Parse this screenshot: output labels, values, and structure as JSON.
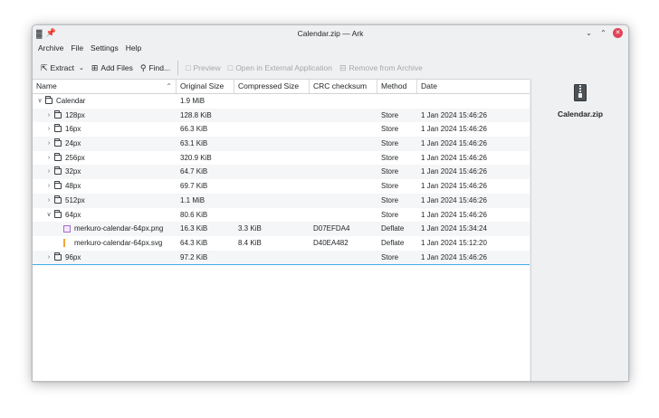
{
  "window": {
    "title": "Calendar.zip — Ark",
    "pin_icon": "pin-icon",
    "app_icon": "ark-app-icon"
  },
  "menubar": {
    "items": [
      "Archive",
      "File",
      "Settings",
      "Help"
    ]
  },
  "toolbar": {
    "extract": "Extract",
    "add_files": "Add Files",
    "find": "Find...",
    "preview": "Preview",
    "open_external": "Open in External Application",
    "remove": "Remove from Archive"
  },
  "table": {
    "columns": [
      "Name",
      "Original Size",
      "Compressed Size",
      "CRC checksum",
      "Method",
      "Date"
    ],
    "rows": [
      {
        "name": "Calendar",
        "original": "1.9 MiB",
        "compressed": "",
        "crc": "",
        "method": "",
        "date": "",
        "type": "folder",
        "expanded": true,
        "depth": 0
      },
      {
        "name": "128px",
        "original": "128.8 KiB",
        "compressed": "",
        "crc": "",
        "method": "Store",
        "date": "1 Jan 2024 15:46:26",
        "type": "folder",
        "expanded": false,
        "depth": 1
      },
      {
        "name": "16px",
        "original": "66.3 KiB",
        "compressed": "",
        "crc": "",
        "method": "Store",
        "date": "1 Jan 2024 15:46:26",
        "type": "folder",
        "expanded": false,
        "depth": 1
      },
      {
        "name": "24px",
        "original": "63.1 KiB",
        "compressed": "",
        "crc": "",
        "method": "Store",
        "date": "1 Jan 2024 15:46:26",
        "type": "folder",
        "expanded": false,
        "depth": 1
      },
      {
        "name": "256px",
        "original": "320.9 KiB",
        "compressed": "",
        "crc": "",
        "method": "Store",
        "date": "1 Jan 2024 15:46:26",
        "type": "folder",
        "expanded": false,
        "depth": 1
      },
      {
        "name": "32px",
        "original": "64.7 KiB",
        "compressed": "",
        "crc": "",
        "method": "Store",
        "date": "1 Jan 2024 15:46:26",
        "type": "folder",
        "expanded": false,
        "depth": 1
      },
      {
        "name": "48px",
        "original": "69.7 KiB",
        "compressed": "",
        "crc": "",
        "method": "Store",
        "date": "1 Jan 2024 15:46:26",
        "type": "folder",
        "expanded": false,
        "depth": 1
      },
      {
        "name": "512px",
        "original": "1.1 MiB",
        "compressed": "",
        "crc": "",
        "method": "Store",
        "date": "1 Jan 2024 15:46:26",
        "type": "folder",
        "expanded": false,
        "depth": 1
      },
      {
        "name": "64px",
        "original": "80.6 KiB",
        "compressed": "",
        "crc": "",
        "method": "Store",
        "date": "1 Jan 2024 15:46:26",
        "type": "folder",
        "expanded": true,
        "depth": 1
      },
      {
        "name": "merkuro-calendar-64px.png",
        "original": "16.3 KiB",
        "compressed": "3.3 KiB",
        "crc": "D07EFDA4",
        "method": "Deflate",
        "date": "1 Jan 2024 15:34:24",
        "type": "png",
        "expanded": false,
        "depth": 2
      },
      {
        "name": "merkuro-calendar-64px.svg",
        "original": "64.3 KiB",
        "compressed": "8.4 KiB",
        "crc": "D40EA482",
        "method": "Deflate",
        "date": "1 Jan 2024 15:12:20",
        "type": "svg",
        "expanded": false,
        "depth": 2
      },
      {
        "name": "96px",
        "original": "97.2 KiB",
        "compressed": "",
        "crc": "",
        "method": "Store",
        "date": "1 Jan 2024 15:46:26",
        "type": "folder",
        "expanded": false,
        "depth": 1
      }
    ]
  },
  "sidebar": {
    "filename": "Calendar.zip",
    "icon": "zip-archive-icon"
  },
  "colors": {
    "window_bg": "#eff0f1",
    "selection": "#3daee9",
    "close_button": "#e0455a"
  }
}
